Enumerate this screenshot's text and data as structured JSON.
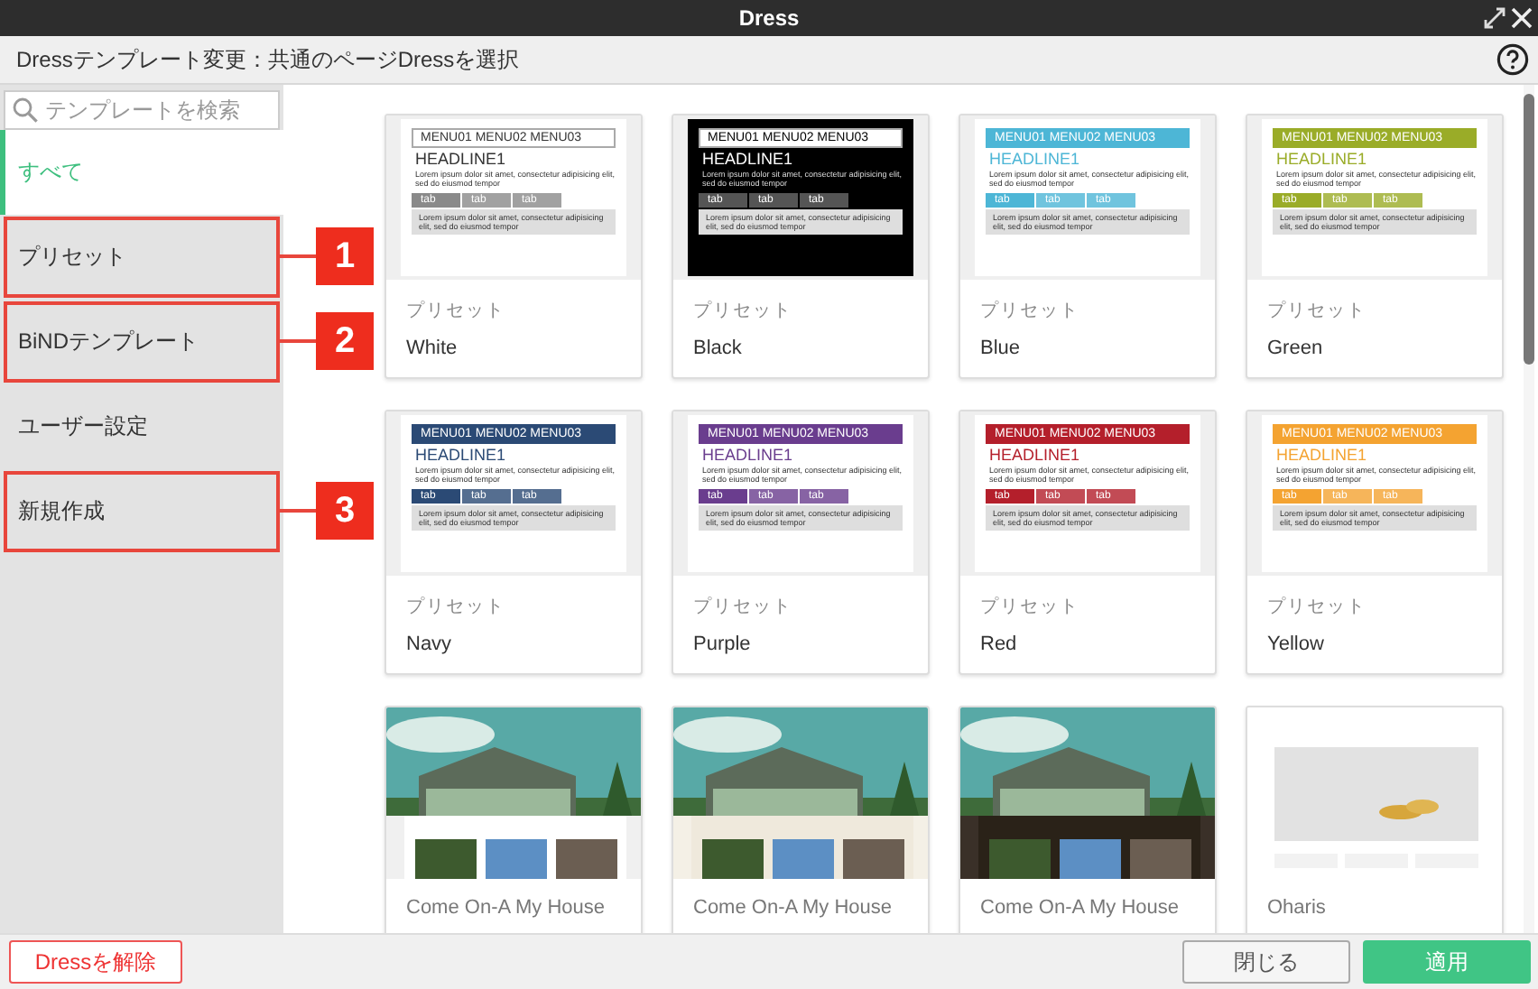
{
  "window": {
    "title": "Dress"
  },
  "header": {
    "title": "Dressテンプレート変更：共通のページDressを選択"
  },
  "search": {
    "placeholder": "テンプレートを検索"
  },
  "sidebar": {
    "items": [
      {
        "label": "すべて",
        "selected": true
      },
      {
        "label": "プリセット",
        "selected": false,
        "callout": "1"
      },
      {
        "label": "BiNDテンプレート",
        "selected": false,
        "callout": "2"
      },
      {
        "label": "ユーザー設定",
        "selected": false
      },
      {
        "label": "新規作成",
        "selected": false,
        "callout": "3"
      }
    ]
  },
  "templates": [
    {
      "kind": "plain",
      "color": "#8a8a8a",
      "category": "プリセット",
      "name": "White",
      "preview": {
        "menu": "MENU01  MENU02  MENU03",
        "headline": "HEADLINE1",
        "text": "Lorem ipsum dolor sit amet, consectetur adipisicing elit, sed do eiusmod tempor",
        "tabs": [
          "tab",
          "tab",
          "tab"
        ],
        "box_text": "Lorem ipsum dolor sit amet, consectetur adipisicing elit, sed do eiusmod tempor"
      }
    },
    {
      "kind": "inverse",
      "color": "#555555",
      "category": "プリセット",
      "name": "Black",
      "preview": {
        "menu": "MENU01  MENU02  MENU03",
        "headline": "HEADLINE1",
        "text": "Lorem ipsum dolor sit amet, consectetur adipisicing elit, sed do eiusmod tempor",
        "tabs": [
          "tab",
          "tab",
          "tab"
        ],
        "box_text": "Lorem ipsum dolor sit amet, consectetur adipisicing elit, sed do eiusmod tempor"
      }
    },
    {
      "kind": "colored",
      "color": "#4db6d6",
      "category": "プリセット",
      "name": "Blue",
      "preview": {
        "menu": "MENU01  MENU02  MENU03",
        "headline": "HEADLINE1",
        "text": "Lorem ipsum dolor sit amet, consectetur adipisicing elit, sed do eiusmod tempor",
        "tabs": [
          "tab",
          "tab",
          "tab"
        ],
        "box_text": "Lorem ipsum dolor sit amet, consectetur adipisicing elit, sed do eiusmod tempor"
      }
    },
    {
      "kind": "colored",
      "color": "#9aac28",
      "category": "プリセット",
      "name": "Green",
      "preview": {
        "menu": "MENU01  MENU02  MENU03",
        "headline": "HEADLINE1",
        "text": "Lorem ipsum dolor sit amet, consectetur adipisicing elit, sed do eiusmod tempor",
        "tabs": [
          "tab",
          "tab",
          "tab"
        ],
        "box_text": "Lorem ipsum dolor sit amet, consectetur adipisicing elit, sed do eiusmod tempor"
      }
    },
    {
      "kind": "colored",
      "color": "#2b4a75",
      "category": "プリセット",
      "name": "Navy",
      "preview": {
        "menu": "MENU01  MENU02  MENU03",
        "headline": "HEADLINE1",
        "text": "Lorem ipsum dolor sit amet, consectetur adipisicing elit, sed do eiusmod tempor",
        "tabs": [
          "tab",
          "tab",
          "tab"
        ],
        "box_text": "Lorem ipsum dolor sit amet, consectetur adipisicing elit, sed do eiusmod tempor"
      }
    },
    {
      "kind": "colored",
      "color": "#6a3d8e",
      "category": "プリセット",
      "name": "Purple",
      "preview": {
        "menu": "MENU01  MENU02  MENU03",
        "headline": "HEADLINE1",
        "text": "Lorem ipsum dolor sit amet, consectetur adipisicing elit, sed do eiusmod tempor",
        "tabs": [
          "tab",
          "tab",
          "tab"
        ],
        "box_text": "Lorem ipsum dolor sit amet, consectetur adipisicing elit, sed do eiusmod tempor"
      }
    },
    {
      "kind": "colored",
      "color": "#b41f2b",
      "category": "プリセット",
      "name": "Red",
      "preview": {
        "menu": "MENU01  MENU02  MENU03",
        "headline": "HEADLINE1",
        "text": "Lorem ipsum dolor sit amet, consectetur adipisicing elit, sed do eiusmod tempor",
        "tabs": [
          "tab",
          "tab",
          "tab"
        ],
        "box_text": "Lorem ipsum dolor sit amet, consectetur adipisicing elit, sed do eiusmod tempor"
      }
    },
    {
      "kind": "colored",
      "color": "#f4a331",
      "category": "プリセット",
      "name": "Yellow",
      "preview": {
        "menu": "MENU01  MENU02  MENU03",
        "headline": "HEADLINE1",
        "text": "Lorem ipsum dolor sit amet, consectetur adipisicing elit, sed do eiusmod tempor",
        "tabs": [
          "tab",
          "tab",
          "tab"
        ],
        "box_text": "Lorem ipsum dolor sit amet, consectetur adipisicing elit, sed do eiusmod tempor"
      }
    },
    {
      "kind": "picture",
      "category": "Come On-A My House"
    },
    {
      "kind": "picture",
      "category": "Come On-A My House"
    },
    {
      "kind": "picture",
      "category": "Come On-A My House"
    },
    {
      "kind": "picture",
      "category": "Oharis"
    }
  ],
  "footer": {
    "remove_button": "Dressを解除",
    "close_button": "閉じる",
    "apply_button": "適用"
  }
}
